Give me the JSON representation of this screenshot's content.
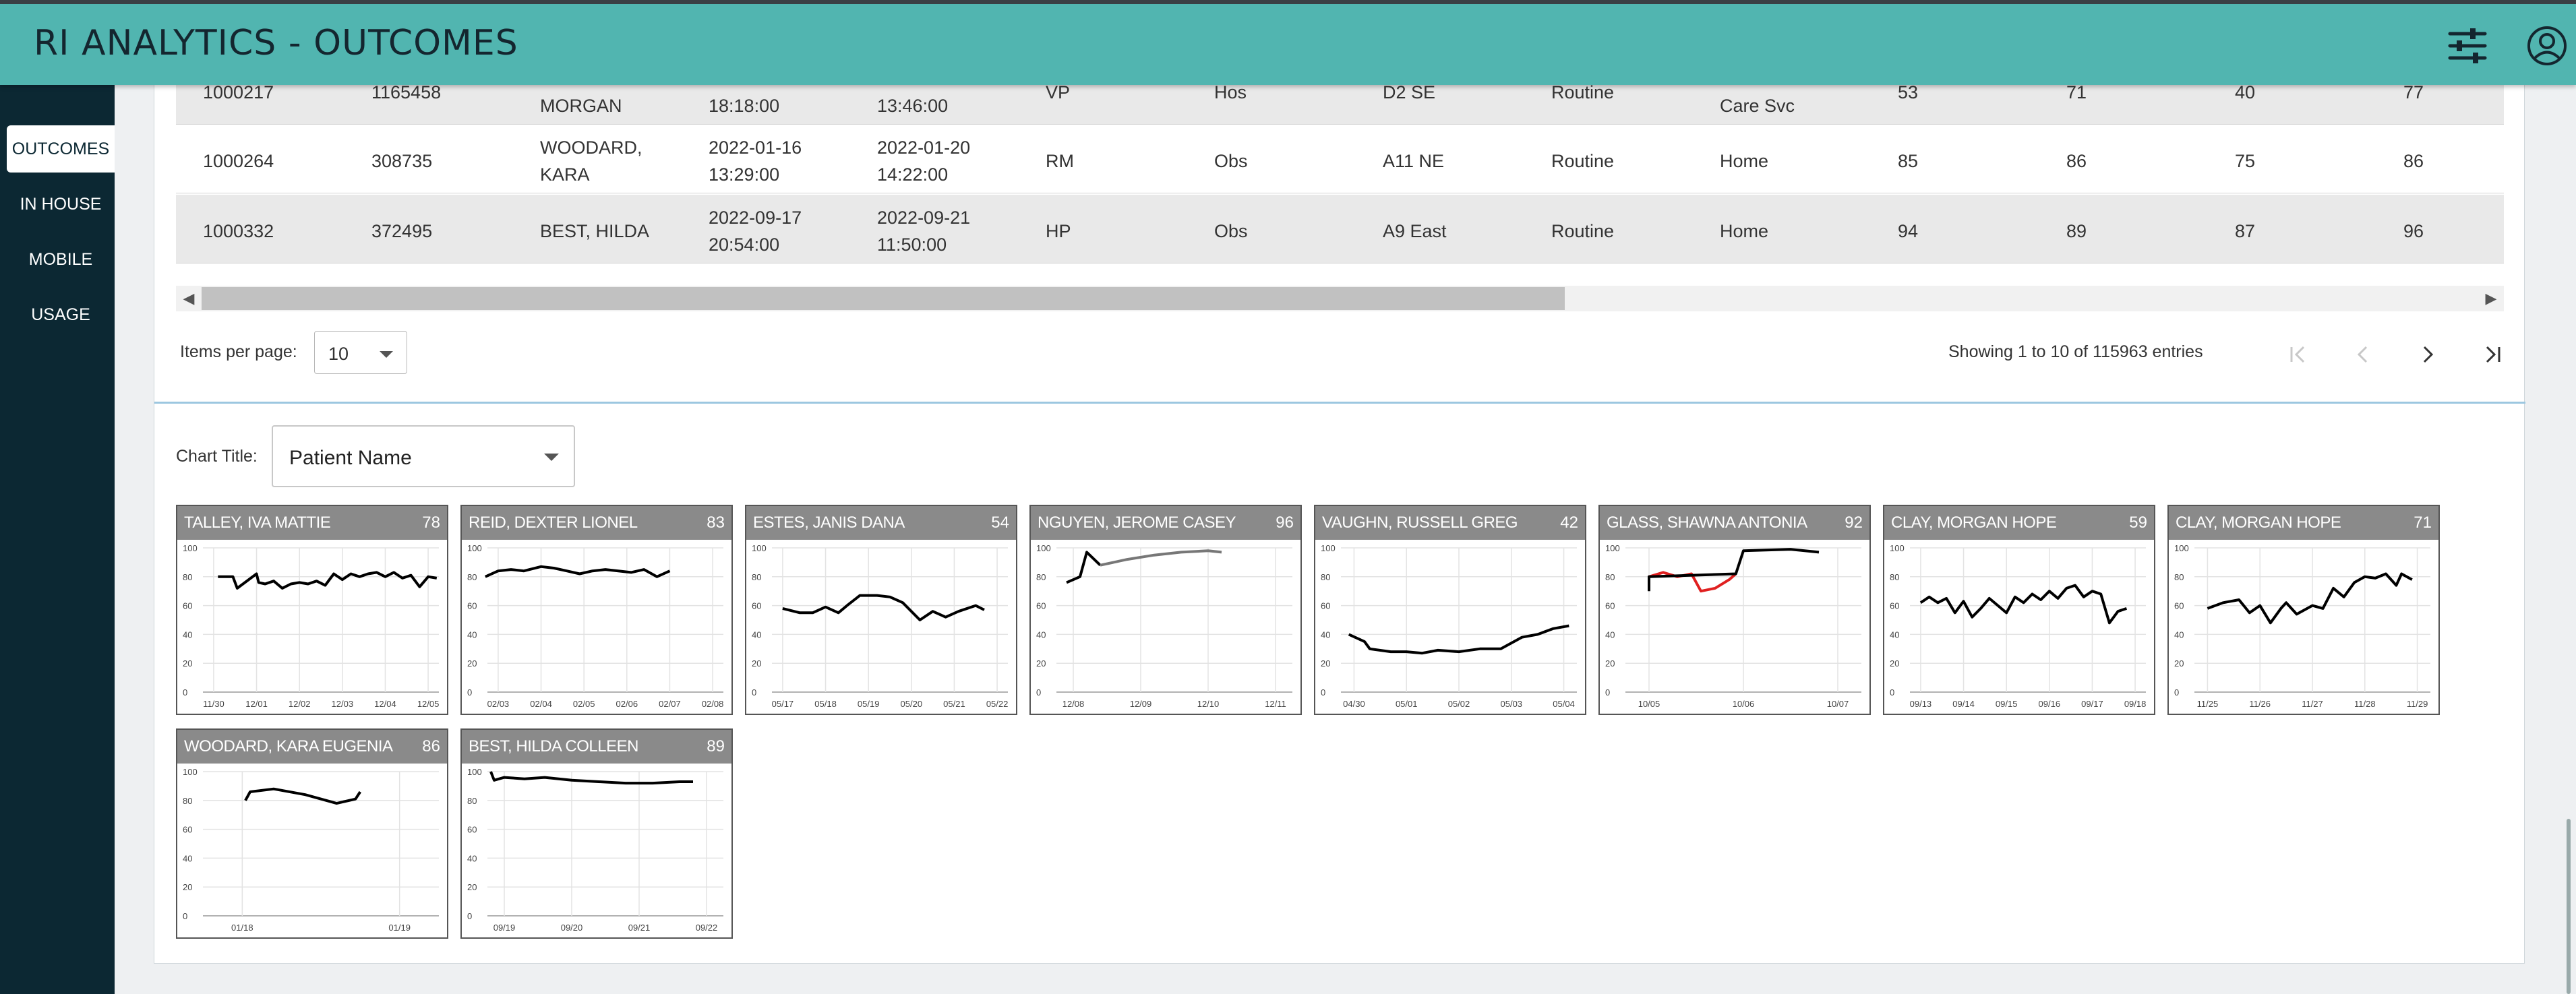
{
  "app": {
    "title": "RI ANALYTICS - OUTCOMES"
  },
  "icons": {
    "settings": "sliders-icon",
    "profile": "user-circle-icon"
  },
  "sidebar": {
    "items": [
      {
        "label": "OUTCOMES",
        "active": true
      },
      {
        "label": "IN HOUSE",
        "active": false
      },
      {
        "label": "MOBILE",
        "active": false
      },
      {
        "label": "USAGE",
        "active": false
      }
    ]
  },
  "table": {
    "rows": [
      {
        "c1": "1000217",
        "c2": "1165458",
        "name_l1": "",
        "name_l2": "MORGAN",
        "admit_date": "",
        "admit_time": "18:18:00",
        "disch_date": "",
        "disch_time": "13:46:00",
        "service": "VP",
        "status": "Hos",
        "unit": "D2 SE",
        "priority": "Routine",
        "dispo_l1": "",
        "dispo_l2": "Care Svc",
        "s1": "53",
        "s2": "71",
        "s3": "40",
        "s4": "77"
      },
      {
        "c1": "1000264",
        "c2": "308735",
        "name_l1": "WOODARD,",
        "name_l2": "KARA",
        "admit_date": "2022-01-16",
        "admit_time": "13:29:00",
        "disch_date": "2022-01-20",
        "disch_time": "14:22:00",
        "service": "RM",
        "status": "Obs",
        "unit": "A11 NE",
        "priority": "Routine",
        "dispo_l1": "Home",
        "dispo_l2": "",
        "s1": "85",
        "s2": "86",
        "s3": "75",
        "s4": "86"
      },
      {
        "c1": "1000332",
        "c2": "372495",
        "name_l1": "BEST, HILDA",
        "name_l2": "",
        "admit_date": "2022-09-17",
        "admit_time": "20:54:00",
        "disch_date": "2022-09-21",
        "disch_time": "11:50:00",
        "service": "HP",
        "status": "Obs",
        "unit": "A9 East",
        "priority": "Routine",
        "dispo_l1": "Home",
        "dispo_l2": "",
        "s1": "94",
        "s2": "89",
        "s3": "87",
        "s4": "96"
      }
    ]
  },
  "pager": {
    "items_per_page_label": "Items per page:",
    "items_per_page_value": "10",
    "showing_text": "Showing 1 to 10 of 115963 entries",
    "first_icon": "first-page-icon",
    "prev_icon": "chevron-left-icon",
    "next_icon": "chevron-right-icon",
    "last_icon": "last-page-icon"
  },
  "chart_controls": {
    "label": "Chart Title:",
    "selected": "Patient Name"
  },
  "chart_data": [
    {
      "type": "line",
      "title": "TALLEY, IVA MATTIE",
      "score": "78",
      "y_ticks": [
        "100",
        "80",
        "60",
        "40",
        "20",
        "0"
      ],
      "ylim": [
        0,
        100
      ],
      "x_ticks": [
        "11/30",
        "12/01",
        "12/02",
        "12/03",
        "12/04",
        "12/05"
      ],
      "series": [
        {
          "color": "#000000",
          "x": [
            0.1,
            0.45,
            0.55,
            1.0,
            1.05,
            1.2,
            1.4,
            1.6,
            1.8,
            2.0,
            2.2,
            2.4,
            2.6,
            2.8,
            3.0,
            3.2,
            3.4,
            3.6,
            3.8,
            4.0,
            4.2,
            4.4,
            4.6,
            4.8,
            5.0,
            5.2
          ],
          "y": [
            80,
            80,
            72,
            82,
            76,
            75,
            77,
            72,
            75,
            76,
            75,
            77,
            74,
            82,
            78,
            82,
            80,
            82,
            83,
            80,
            83,
            79,
            81,
            73,
            80,
            79
          ]
        }
      ]
    },
    {
      "type": "line",
      "title": "REID, DEXTER LIONEL",
      "score": "83",
      "y_ticks": [
        "100",
        "80",
        "60",
        "40",
        "20",
        "0"
      ],
      "ylim": [
        0,
        100
      ],
      "x_ticks": [
        "02/03",
        "02/04",
        "02/05",
        "02/06",
        "02/07",
        "02/08"
      ],
      "series": [
        {
          "color": "#000000",
          "x": [
            -0.3,
            0.0,
            0.3,
            0.6,
            1.0,
            1.3,
            1.6,
            1.9,
            2.2,
            2.5,
            2.8,
            3.1,
            3.4,
            3.7,
            4.0
          ],
          "y": [
            80,
            84,
            85,
            84,
            87,
            86,
            84,
            82,
            84,
            85,
            84,
            83,
            85,
            80,
            84
          ]
        }
      ]
    },
    {
      "type": "line",
      "title": "ESTES, JANIS DANA",
      "score": "54",
      "y_ticks": [
        "100",
        "80",
        "60",
        "40",
        "20",
        "0"
      ],
      "ylim": [
        0,
        100
      ],
      "x_ticks": [
        "05/17",
        "05/18",
        "05/19",
        "05/20",
        "05/21",
        "05/22"
      ],
      "series": [
        {
          "color": "#000000",
          "x": [
            0.0,
            0.4,
            0.7,
            1.0,
            1.3,
            1.5,
            1.8,
            2.2,
            2.5,
            2.8,
            3.2,
            3.5,
            3.8,
            4.1,
            4.5,
            4.7
          ],
          "y": [
            58,
            55,
            55,
            59,
            55,
            60,
            67,
            67,
            66,
            62,
            50,
            56,
            52,
            56,
            60,
            57
          ]
        }
      ]
    },
    {
      "type": "line",
      "title": "NGUYEN, JEROME CASEY",
      "score": "96",
      "y_ticks": [
        "100",
        "80",
        "60",
        "40",
        "20",
        "0"
      ],
      "ylim": [
        0,
        100
      ],
      "x_ticks": [
        "12/08",
        "12/09",
        "12/10",
        "12/11"
      ],
      "series": [
        {
          "color": "#000000",
          "x": [
            -0.1,
            0.1,
            0.2,
            0.4
          ],
          "y": [
            76,
            80,
            97,
            88
          ]
        },
        {
          "color": "#777777",
          "x": [
            0.4,
            0.8,
            1.2,
            1.6,
            2.0,
            2.2
          ],
          "y": [
            88,
            92,
            95,
            97,
            98,
            97
          ]
        }
      ]
    },
    {
      "type": "line",
      "title": "VAUGHN, RUSSELL GREG",
      "score": "42",
      "y_ticks": [
        "100",
        "80",
        "60",
        "40",
        "20",
        "0"
      ],
      "ylim": [
        0,
        100
      ],
      "x_ticks": [
        "04/30",
        "05/01",
        "05/02",
        "05/03",
        "05/04"
      ],
      "series": [
        {
          "color": "#000000",
          "x": [
            -0.1,
            0.2,
            0.3,
            0.7,
            1.0,
            1.3,
            1.6,
            2.0,
            2.4,
            2.8,
            3.2,
            3.5,
            3.8,
            4.1
          ],
          "y": [
            40,
            35,
            30,
            28,
            28,
            27,
            29,
            28,
            30,
            30,
            38,
            40,
            44,
            46
          ]
        }
      ]
    },
    {
      "type": "line",
      "title": "GLASS, SHAWNA ANTONIA",
      "score": "92",
      "y_ticks": [
        "100",
        "80",
        "60",
        "40",
        "20",
        "0"
      ],
      "ylim": [
        0,
        100
      ],
      "x_ticks": [
        "10/05",
        "10/06",
        "10/07"
      ],
      "series": [
        {
          "color": "#e02020",
          "x": [
            0.0,
            0.15,
            0.3,
            0.45,
            0.55,
            0.7,
            0.85,
            0.92
          ],
          "y": [
            80,
            83,
            80,
            82,
            70,
            72,
            78,
            82
          ]
        },
        {
          "color": "#000000",
          "x": [
            0.0,
            0.0,
            0.92,
            1.0,
            1.5,
            1.8
          ],
          "y": [
            70,
            80,
            82,
            98,
            99,
            97
          ]
        }
      ]
    },
    {
      "type": "line",
      "title": "CLAY, MORGAN HOPE",
      "score": "59",
      "y_ticks": [
        "100",
        "80",
        "60",
        "40",
        "20",
        "0"
      ],
      "ylim": [
        0,
        100
      ],
      "x_ticks": [
        "09/13",
        "09/14",
        "09/15",
        "09/16",
        "09/17",
        "09/18"
      ],
      "series": [
        {
          "color": "#000000",
          "x": [
            0.0,
            0.2,
            0.4,
            0.6,
            0.8,
            1.0,
            1.2,
            1.4,
            1.6,
            1.8,
            2.0,
            2.2,
            2.4,
            2.6,
            2.8,
            3.0,
            3.2,
            3.4,
            3.6,
            3.8,
            4.0,
            4.2,
            4.4,
            4.6,
            4.8
          ],
          "y": [
            62,
            66,
            62,
            65,
            55,
            63,
            52,
            58,
            65,
            60,
            55,
            66,
            62,
            68,
            64,
            70,
            65,
            72,
            74,
            66,
            70,
            68,
            48,
            56,
            58
          ]
        }
      ]
    },
    {
      "type": "line",
      "title": "CLAY, MORGAN HOPE",
      "score": "71",
      "y_ticks": [
        "100",
        "80",
        "60",
        "40",
        "20",
        "0"
      ],
      "ylim": [
        0,
        100
      ],
      "x_ticks": [
        "11/25",
        "11/26",
        "11/27",
        "11/28",
        "11/29"
      ],
      "series": [
        {
          "color": "#000000",
          "x": [
            0.0,
            0.3,
            0.6,
            0.8,
            1.0,
            1.2,
            1.4,
            1.5,
            1.7,
            2.0,
            2.2,
            2.4,
            2.6,
            2.8,
            3.0,
            3.2,
            3.4,
            3.6,
            3.7,
            3.9
          ],
          "y": [
            58,
            62,
            64,
            55,
            60,
            48,
            58,
            62,
            54,
            60,
            58,
            72,
            66,
            76,
            80,
            79,
            82,
            74,
            82,
            78
          ]
        }
      ]
    },
    {
      "type": "line",
      "title": "WOODARD, KARA EUGENIA",
      "score": "86",
      "y_ticks": [
        "100",
        "80",
        "60",
        "40",
        "20",
        "0"
      ],
      "ylim": [
        0,
        100
      ],
      "x_ticks": [
        "01/18",
        "01/19"
      ],
      "series": [
        {
          "color": "#000000",
          "x": [
            0.02,
            0.05,
            0.2,
            0.4,
            0.6,
            0.72,
            0.75
          ],
          "y": [
            80,
            86,
            88,
            84,
            78,
            81,
            86
          ]
        }
      ]
    },
    {
      "type": "line",
      "title": "BEST, HILDA COLLEEN",
      "score": "89",
      "y_ticks": [
        "100",
        "80",
        "60",
        "40",
        "20",
        "0"
      ],
      "ylim": [
        0,
        100
      ],
      "x_ticks": [
        "09/19",
        "09/20",
        "09/21",
        "09/22"
      ],
      "series": [
        {
          "color": "#000000",
          "x": [
            -0.2,
            -0.15,
            0.0,
            0.3,
            0.6,
            1.0,
            1.4,
            1.8,
            2.2,
            2.6,
            2.8
          ],
          "y": [
            100,
            94,
            96,
            95,
            96,
            94,
            93,
            92,
            92,
            93,
            93
          ]
        }
      ]
    }
  ]
}
